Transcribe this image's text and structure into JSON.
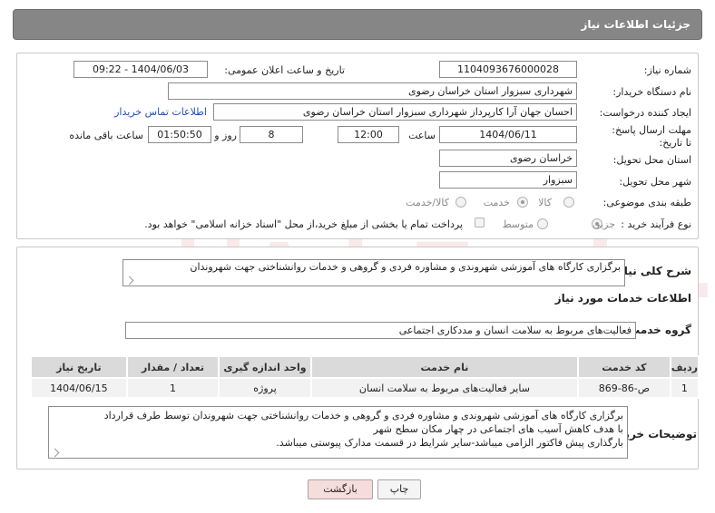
{
  "header": {
    "title": "جزئیات اطلاعات نیاز"
  },
  "fields": {
    "need_number_label": "شماره نیاز:",
    "need_number": "1104093676000028",
    "announce_datetime_label": "تاریخ و ساعت اعلان عمومی:",
    "announce_datetime": "1404/06/03 - 09:22",
    "buyer_org_label": "نام دستگاه خریدار:",
    "buyer_org": "شهرداری سبزوار استان خراسان رضوی",
    "creator_label": "ایجاد کننده درخواست:",
    "creator": "احسان جهان آرا کارپرداز شهرداری سبزوار استان خراسان رضوی",
    "contact_link": "اطلاعات تماس خریدار",
    "deadline_label": "مهلت ارسال پاسخ: تا تاریخ:",
    "deadline_date": "1404/06/11",
    "time_label": "ساعت",
    "deadline_time": "12:00",
    "days_value": "8",
    "days_label": "روز و",
    "remaining_time": "01:50:50",
    "remaining_label": "ساعت باقی مانده",
    "province_label": "استان محل تحویل:",
    "province": "خراسان رضوی",
    "city_label": "شهر محل تحویل:",
    "city": "سبزوار",
    "category_label": "طبقه بندی موضوعی:",
    "category_options": [
      "کالا",
      "خدمت",
      "کالا/خدمت"
    ],
    "category_selected": "خدمت",
    "process_label": "نوع فرآیند خرید :",
    "process_options": [
      "جزیی",
      "متوسط"
    ],
    "process_selected": "جزیی",
    "payment_note": "پرداخت تمام یا بخشی از مبلغ خرید،از محل \"اسناد خزانه اسلامی\" خواهد بود."
  },
  "summary": {
    "label": "شرح کلی نیاز:",
    "text": "برگزاری کارگاه های آموزشی شهروندی و مشاوره فردی و گروهی و خدمات روانشناختی جهت شهروندان"
  },
  "services": {
    "section_title": "اطلاعات خدمات مورد نیاز",
    "group_label": "گروه خدمت:",
    "group_value": "فعالیت‌های مربوط به سلامت انسان و مددکاری اجتماعی",
    "columns": [
      "ردیف",
      "کد خدمت",
      "نام خدمت",
      "واحد اندازه گیری",
      "تعداد / مقدار",
      "تاریخ نیاز"
    ],
    "rows": [
      [
        "1",
        "ص-86-869",
        "سایر فعالیت‌های مربوط به سلامت انسان",
        "پروژه",
        "1",
        "1404/06/15"
      ]
    ]
  },
  "buyer_notes": {
    "label": "توضیحات خریدار:",
    "lines": [
      "برگزاری کارگاه های آموزشی شهروندی و مشاوره فردی و گروهی و خدمات روانشناختی جهت شهروندان توسط طرف قرارداد",
      "با هدف کاهش آسیب های اجتماعی در چهار مکان سطح شهر",
      "بارگذاری پیش فاکتور الزامی میباشد-سایر شرایط در قسمت مدارک پیوستی میباشد."
    ]
  },
  "buttons": {
    "print": "چاپ",
    "back": "بازگشت"
  },
  "watermark": {
    "text": "AriaTender.net"
  },
  "colors": {
    "header_bg": "#868686",
    "link": "#1f4fb5",
    "back_button_bg": "#f7dcdc"
  }
}
